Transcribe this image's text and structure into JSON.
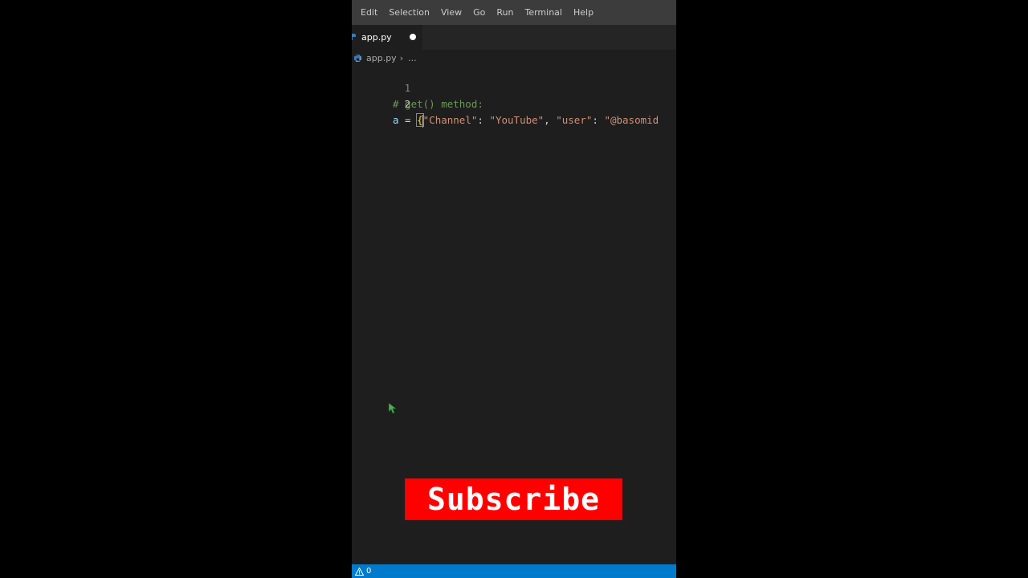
{
  "menu": [
    "Edit",
    "Selection",
    "View",
    "Go",
    "Run",
    "Terminal",
    "Help"
  ],
  "tab": {
    "label": "app.py",
    "modified": true
  },
  "breadcrumb": {
    "file": "app.py",
    "separator": "›",
    "more": "..."
  },
  "editor": {
    "lines": [
      {
        "number": "1",
        "comment": "# get() method:"
      },
      {
        "number": "2",
        "var": "a",
        "op": " = ",
        "brace": "{",
        "q1": "\"Channel\"",
        "colon1": ": ",
        "q2": "\"YouTube\"",
        "comma1": ", ",
        "q3": "\"user\"",
        "colon2": ": ",
        "q4": "\"@basomid"
      }
    ]
  },
  "overlay": {
    "subscribe_label": "Subscribe"
  },
  "statusbar": {
    "problems": "0"
  },
  "colors": {
    "subscribe_bg": "#ff0000",
    "statusbar_bg": "#007acc",
    "editor_bg": "#1e1e1e"
  },
  "icons": {
    "file": "python-file-icon",
    "status": "warning-icon",
    "pointer": "mouse-pointer-icon"
  }
}
